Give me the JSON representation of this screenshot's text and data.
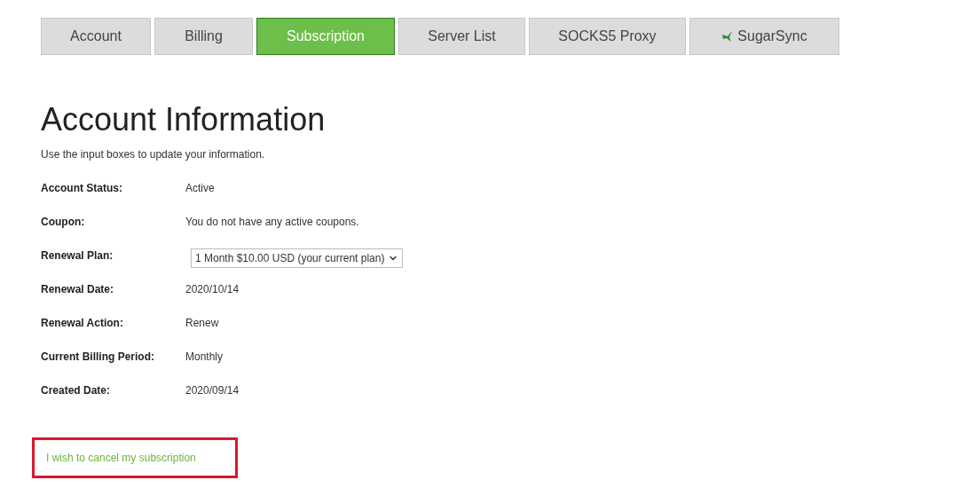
{
  "tabs": [
    {
      "label": "Account",
      "selected": false,
      "kind": "plain"
    },
    {
      "label": "Billing",
      "selected": false,
      "kind": "plain"
    },
    {
      "label": "Subscription",
      "selected": true,
      "kind": "plain"
    },
    {
      "label": "Server List",
      "selected": false,
      "kind": "plain"
    },
    {
      "label": "SOCKS5 Proxy",
      "selected": false,
      "kind": "plain"
    },
    {
      "label": "SugarSync",
      "selected": false,
      "kind": "icon"
    }
  ],
  "heading": "Account Information",
  "description": "Use the input boxes to update your information.",
  "fields": [
    {
      "label": "Account Status:",
      "kind": "text",
      "value": "Active"
    },
    {
      "label": "Coupon:",
      "kind": "text",
      "value": "You do not have any active coupons."
    },
    {
      "label": "Renewal Plan:",
      "kind": "select",
      "value": "1 Month $10.00 USD (your current plan)"
    },
    {
      "label": "Renewal Date:",
      "kind": "text",
      "value": "2020/10/14"
    },
    {
      "label": "Renewal Action:",
      "kind": "text",
      "value": "Renew"
    },
    {
      "label": "Current Billing Period:",
      "kind": "text",
      "value": "Monthly"
    },
    {
      "label": "Created Date:",
      "kind": "text",
      "value": "2020/09/14"
    }
  ],
  "cancel_link": {
    "label": "I wish to cancel my subscription",
    "highlighted": true
  }
}
